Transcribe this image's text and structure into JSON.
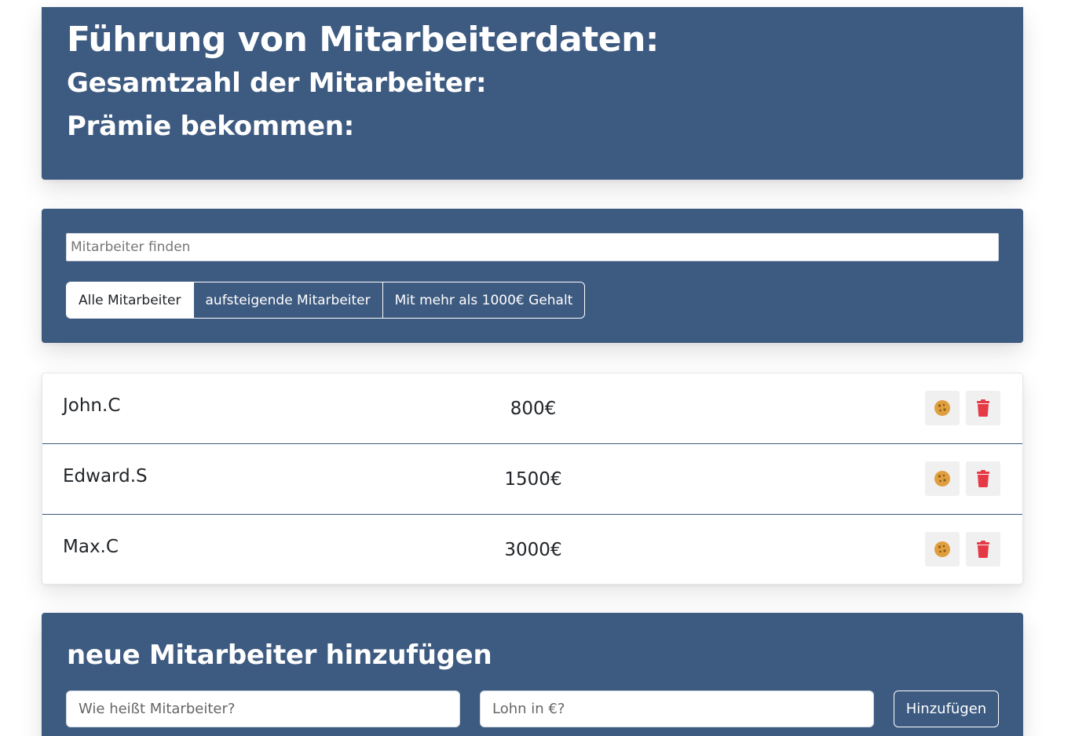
{
  "header": {
    "title": "Führung von Mitarbeiterdaten:",
    "total_label": "Gesamtzahl der Mitarbeiter:",
    "bonus_label": "Prämie bekommen:"
  },
  "search": {
    "placeholder": "Mitarbeiter finden",
    "filters": [
      {
        "label": "Alle Mitarbeiter",
        "active": true
      },
      {
        "label": "aufsteigende Mitarbeiter",
        "active": false
      },
      {
        "label": "Mit mehr als 1000€ Gehalt",
        "active": false
      }
    ]
  },
  "employees": [
    {
      "name": "John.C",
      "salary": "800€"
    },
    {
      "name": "Edward.S",
      "salary": "1500€"
    },
    {
      "name": "Max.C",
      "salary": "3000€"
    }
  ],
  "icons": {
    "cookie": "cookie-icon",
    "trash": "trash-icon"
  },
  "colors": {
    "panel": "#3d5a80",
    "cookie": "#e09f3e",
    "trash": "#e63946"
  },
  "add_form": {
    "title": "neue Mitarbeiter hinzufügen",
    "name_placeholder": "Wie heißt Mitarbeiter?",
    "salary_placeholder": "Lohn in €?",
    "submit_label": "Hinzufügen"
  }
}
